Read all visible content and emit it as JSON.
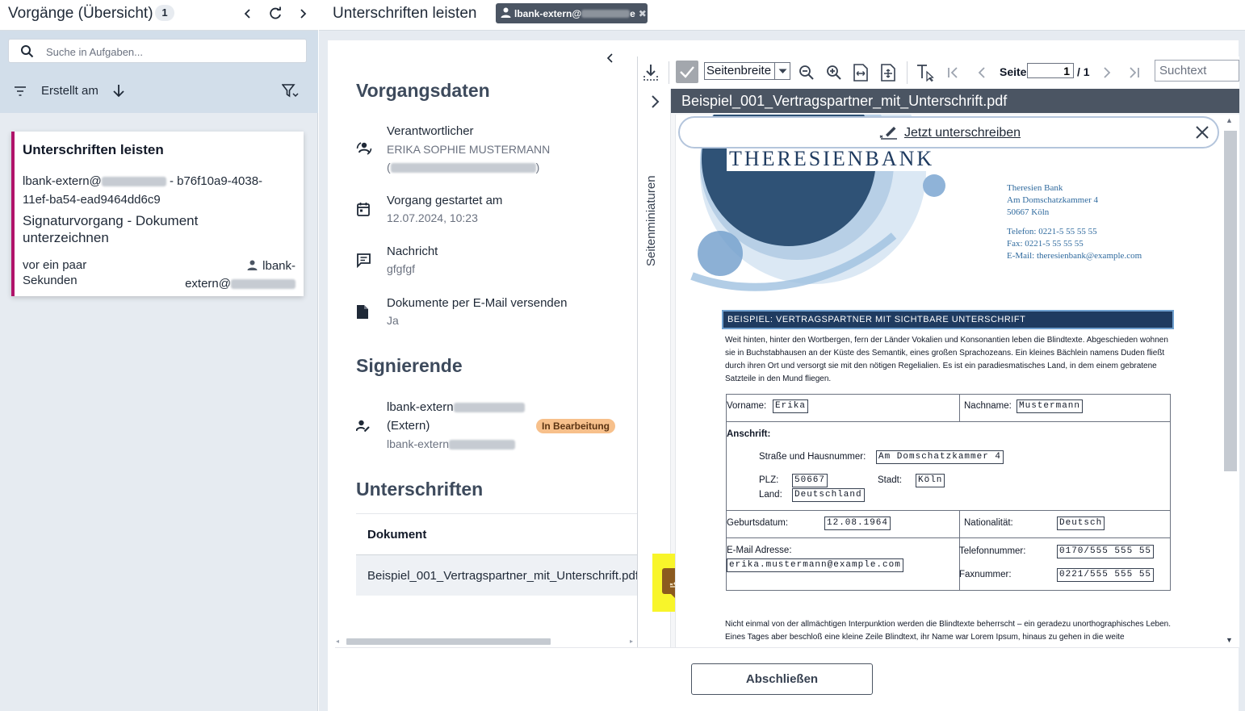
{
  "left_panel": {
    "title": "Vorgänge (Übersicht)",
    "count": "1",
    "search_placeholder": "Suche in Aufgaben...",
    "sort_label": "Erstellt am",
    "task": {
      "title": "Unterschriften leisten",
      "id_prefix": "lbank-extern@",
      "id_suffix": " - b76f10a9-4038-11ef-ba54-ead9464dd6c9",
      "description": "Signaturvorgang - Dokument unterzeichnen",
      "time": "vor ein paar Sekunden",
      "user_line1": "lbank-",
      "user_line2": "extern@"
    }
  },
  "header": {
    "title": "Unterschriften leisten",
    "user_chip": "lbank-extern@",
    "user_chip_suffix": "e"
  },
  "details": {
    "section_vorgang": "Vorgangsdaten",
    "responsible_label": "Verantwortlicher",
    "responsible_value": "ERIKA SOPHIE MUSTERMANN",
    "responsible_paren_open": "(",
    "responsible_paren_close": ")",
    "started_label": "Vorgang gestartet am",
    "started_value": "12.07.2024, 10:23",
    "message_label": "Nachricht",
    "message_value": "gfgfgf",
    "email_label": "Dokumente per E-Mail versenden",
    "email_value": "Ja",
    "section_signers": "Signierende",
    "signer_name": "lbank-extern",
    "signer_type": "(Extern)",
    "signer_sub": "lbank-extern",
    "signer_status": "In Bearbeitung",
    "section_signatures": "Unterschriften",
    "doc_column": "Dokument",
    "doc_row": "Beispiel_001_Vertragspartner_mit_Unterschrift.pdf"
  },
  "viewer": {
    "zoom_value": "Seitenbreite",
    "page_label": "Seite",
    "page_current": "1",
    "page_total": "/ 1",
    "search_placeholder": "Suchtext",
    "thumbnails_label": "Seitenminiaturen",
    "doc_title": "Beispiel_001_Vertragspartner_mit_Unterschrift.pdf",
    "sign_now": "Jetzt unterschreiben"
  },
  "pdf": {
    "bank_name": "THERESIENBANK",
    "address": [
      "Theresien Bank",
      "Am Domschatzkammer 4",
      "50667 Köln",
      "",
      "Telefon: 0221-5 55 55 55",
      "Fax: 0221-5 55 55 55",
      "E-Mail: theresienbank@example.com"
    ],
    "banner": "BEISPIEL: VERTRAGSPARTNER MIT SICHTBARE UNTERSCHRIFT",
    "intro": "Weit hinten, hinter den Wortbergen, fern der Länder Vokalien und Konsonantien leben die Blindtexte. Abgeschieden wohnen sie in Buchstabhausen an der Küste des Semantik, eines großen Sprachozeans. Ein kleines Bächlein namens Duden fließt durch ihren Ort und versorgt sie mit den nötigen Regelialien. Es ist ein paradiesmatisches Land, in dem einem gebratene Satzteile in den Mund fliegen.",
    "form": {
      "vorname_label": "Vorname:",
      "vorname": "Erika",
      "nachname_label": "Nachname:",
      "nachname": "Mustermann",
      "anschrift_label": "Anschrift:",
      "strasse_label": "Straße und Hausnummer:",
      "strasse": "Am Domschatzkammer 4",
      "plz_label": "PLZ:",
      "plz": "50667",
      "stadt_label": "Stadt:",
      "stadt": "Köln",
      "land_label": "Land:",
      "land": "Deutschland",
      "geburt_label": "Geburtsdatum:",
      "geburt": "12.08.1964",
      "nation_label": "Nationalität:",
      "nation": "Deutsch",
      "email_label": "E-Mail Adresse:",
      "email": "erika.mustermann@example.com",
      "tel_label": "Telefonnummer:",
      "tel": "0170/555 555 55",
      "fax_label": "Faxnummer:",
      "fax": "0221/555 555 55"
    },
    "outro": "Nicht einmal von der allmächtigen Interpunktion werden die Blindtexte beherrscht – ein geradezu unorthographisches Leben. Eines Tages aber beschloß eine kleine Zeile Blindtext, ihr Name war Lorem Ipsum, hinaus zu gehen in die weite"
  },
  "footer": {
    "finish_label": "Abschließen"
  },
  "colors": {
    "accent": "#b0136a",
    "status_badge": "#f7c08b",
    "signature_marker": "#f8f52a",
    "doc_titlebar": "#4b5563"
  }
}
